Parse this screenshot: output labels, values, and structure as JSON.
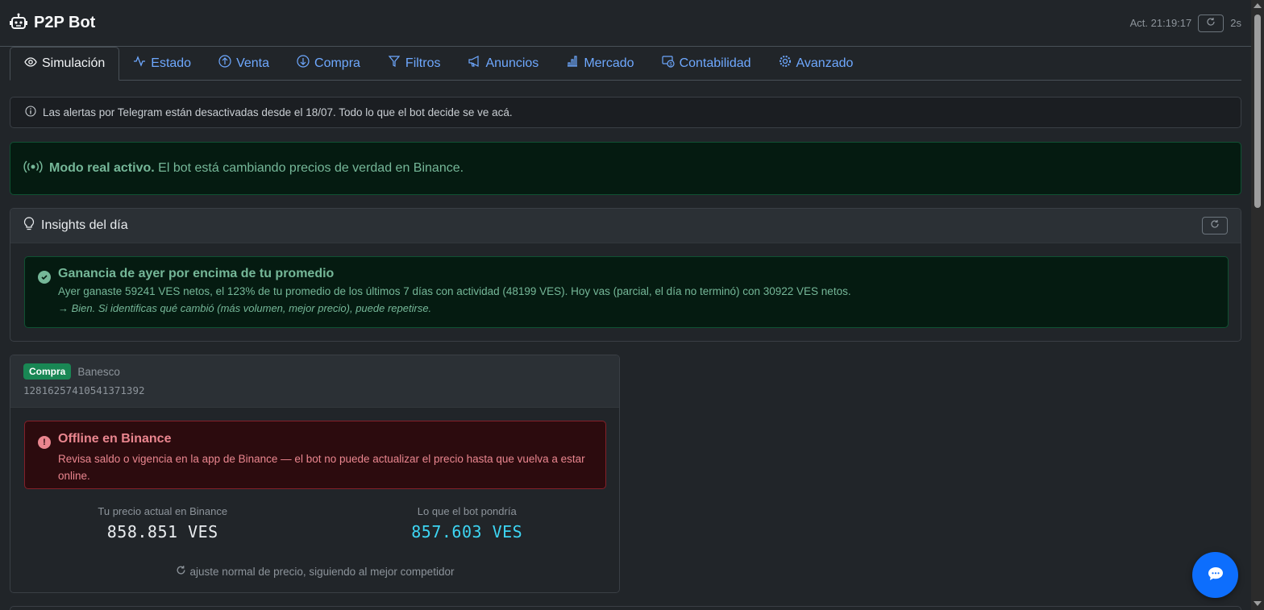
{
  "app": {
    "title": "P2P Bot",
    "updated_label": "Act. 21:19:17",
    "interval": "2s"
  },
  "tabs": [
    {
      "label": "Simulación",
      "icon": "eye-icon",
      "active": true
    },
    {
      "label": "Estado",
      "icon": "activity-icon"
    },
    {
      "label": "Venta",
      "icon": "arrow-up-circle-icon"
    },
    {
      "label": "Compra",
      "icon": "arrow-down-circle-icon"
    },
    {
      "label": "Filtros",
      "icon": "funnel-icon"
    },
    {
      "label": "Anuncios",
      "icon": "megaphone-icon"
    },
    {
      "label": "Mercado",
      "icon": "bar-chart-icon"
    },
    {
      "label": "Contabilidad",
      "icon": "cash-coin-icon"
    },
    {
      "label": "Avanzado",
      "icon": "gear-icon"
    }
  ],
  "info": {
    "text": "Las alertas por Telegram están desactivadas desde el 18/07. Todo lo que el bot decide se ve acá."
  },
  "mode": {
    "strong": "Modo real activo.",
    "text": " El bot está cambiando precios de verdad en Binance."
  },
  "insights": {
    "title": "Insights del día",
    "item": {
      "title": "Ganancia de ayer por encima de tu promedio",
      "text": "Ayer ganaste 59241 VES netos, el 123% de tu promedio de los últimos 7 días con actividad (48199 VES). Hoy vas (parcial, el día no terminó) con 30922 VES netos.",
      "note": "→ Bien. Si identificas qué cambió (más volumen, mejor precio), puede repetirse."
    }
  },
  "order": {
    "badge": "Compra",
    "bank": "Banesco",
    "id": "12816257410541371392",
    "alert": {
      "title": "Offline en Binance",
      "text": "Revisa saldo o vigencia en la app de Binance — el bot no puede actualizar el precio hasta que vuelva a estar online."
    },
    "current_label": "Tu precio actual en Binance",
    "current_value": "858.851 VES",
    "proposed_label": "Lo que el bot pondría",
    "proposed_value": "857.603 VES",
    "adjust_text": "ajuste normal de precio, siguiendo al mejor competidor"
  },
  "colors": {
    "accent": "#6ea8fe",
    "success": "#75b798",
    "danger": "#ea868f",
    "badge": "#198754",
    "price_blue": "#3dd5f3",
    "chat": "#0d6efd"
  }
}
